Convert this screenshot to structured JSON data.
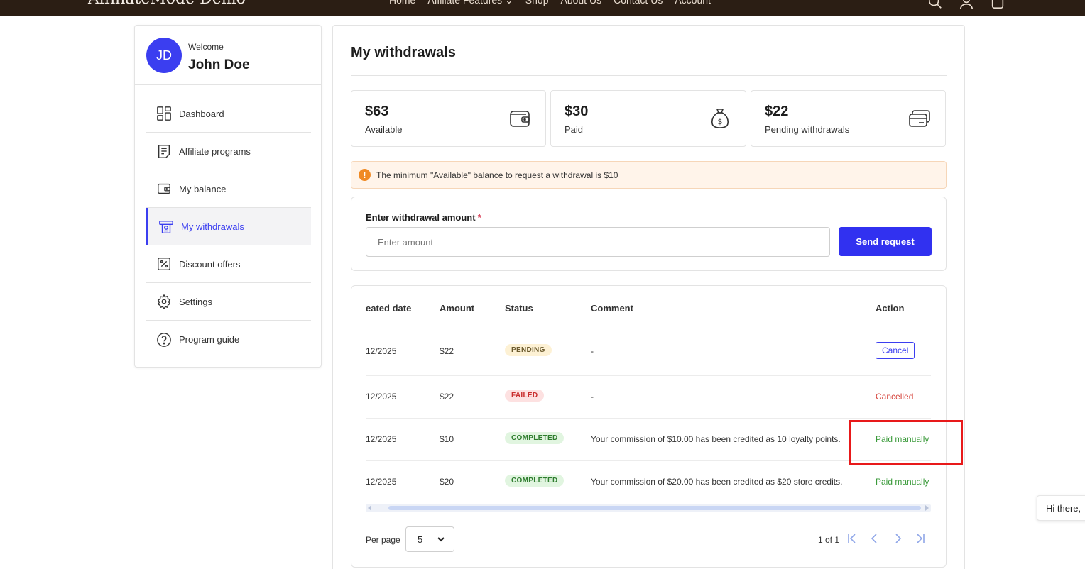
{
  "header": {
    "brand": "AffiliateMode Demo",
    "nav": [
      "Home",
      "Affiliate Features",
      "Shop",
      "About Us",
      "Contact Us",
      "Account"
    ]
  },
  "profile": {
    "initials": "JD",
    "welcome": "Welcome",
    "name": "John Doe"
  },
  "sidebar": {
    "items": [
      {
        "label": "Dashboard",
        "icon": "dashboard-icon"
      },
      {
        "label": "Affiliate programs",
        "icon": "list-icon"
      },
      {
        "label": "My balance",
        "icon": "wallet-icon"
      },
      {
        "label": "My withdrawals",
        "icon": "atm-icon",
        "active": true
      },
      {
        "label": "Discount offers",
        "icon": "percent-icon"
      },
      {
        "label": "Settings",
        "icon": "gear-icon"
      },
      {
        "label": "Program guide",
        "icon": "help-icon"
      }
    ]
  },
  "main": {
    "title": "My withdrawals",
    "stats": [
      {
        "amount": "$63",
        "label": "Available",
        "icon": "wallet-icon"
      },
      {
        "amount": "$30",
        "label": "Paid",
        "icon": "money-bag-icon"
      },
      {
        "amount": "$22",
        "label": "Pending withdrawals",
        "icon": "card-icon"
      }
    ],
    "notice": "The minimum \"Available\" balance to request a withdrawal is $10",
    "form": {
      "label": "Enter withdrawal amount",
      "required_mark": "*",
      "placeholder": "Enter amount",
      "submit_label": "Send request"
    },
    "table": {
      "headers": [
        "eated date",
        "Amount",
        "Status",
        "Comment",
        "Action"
      ],
      "rows": [
        {
          "date": "12/2025",
          "amount": "$22",
          "status": "PENDING",
          "comment": "-",
          "action": "Cancel"
        },
        {
          "date": "12/2025",
          "amount": "$22",
          "status": "FAILED",
          "comment": "-",
          "action": "Cancelled"
        },
        {
          "date": "12/2025",
          "amount": "$10",
          "status": "COMPLETED",
          "comment": "Your commission of $10.00 has been credited as 10 loyalty points.",
          "action": "Paid manually"
        },
        {
          "date": "12/2025",
          "amount": "$20",
          "status": "COMPLETED",
          "comment": "Your commission of $20.00 has been credited as $20 store credits.",
          "action": "Paid manually"
        }
      ]
    },
    "pagination": {
      "per_page_label": "Per page",
      "per_page_value": "5",
      "page_info": "1 of 1"
    }
  },
  "chat": {
    "text": "Hi there,"
  },
  "colors": {
    "accent": "#3b3ef0",
    "header_bg": "#2b1e14",
    "success": "#3a9a3a",
    "danger": "#d6453d",
    "highlight": "#e8191a"
  }
}
